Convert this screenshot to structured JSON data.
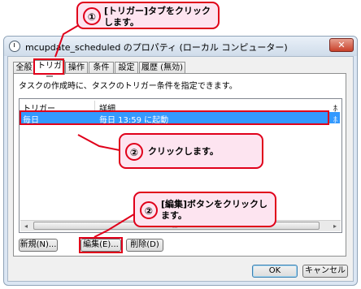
{
  "window": {
    "title": "mcupdate_scheduled のプロパティ (ローカル コンピューター)",
    "close_label": "✕"
  },
  "tabs": [
    {
      "label": "全般"
    },
    {
      "label": "トリガー"
    },
    {
      "label": "操作"
    },
    {
      "label": "条件"
    },
    {
      "label": "設定"
    },
    {
      "label": "履歴 (無効)"
    }
  ],
  "triggers_panel": {
    "description": "タスクの作成時に、タスクのトリガー条件を指定できます。",
    "columns": [
      "トリガー",
      "詳細",
      "ﾎ"
    ],
    "rows": [
      {
        "trigger": "毎日",
        "details": "毎日 13:59 に起動",
        "overflow": "ﾎ"
      }
    ],
    "scroll_grip": "III",
    "scroll_left": "◂",
    "scroll_right": "▸"
  },
  "buttons": {
    "new": "新規(N)...",
    "edit": "編集(E)...",
    "delete": "削除(D)",
    "ok": "OK",
    "cancel": "キャンセル"
  },
  "callouts": [
    {
      "number": "①",
      "text_line1": "[トリガー]タブをクリック",
      "text_line2": "します。"
    },
    {
      "number": "②",
      "text_line1": "クリックします。"
    },
    {
      "number": "②",
      "text_line1": "[編集]ボタンをクリックし",
      "text_line2": "ます。"
    }
  ],
  "colors": {
    "highlight": "#e0001a",
    "callout_fill": "#fde4f0",
    "selection": "#3399ff"
  }
}
